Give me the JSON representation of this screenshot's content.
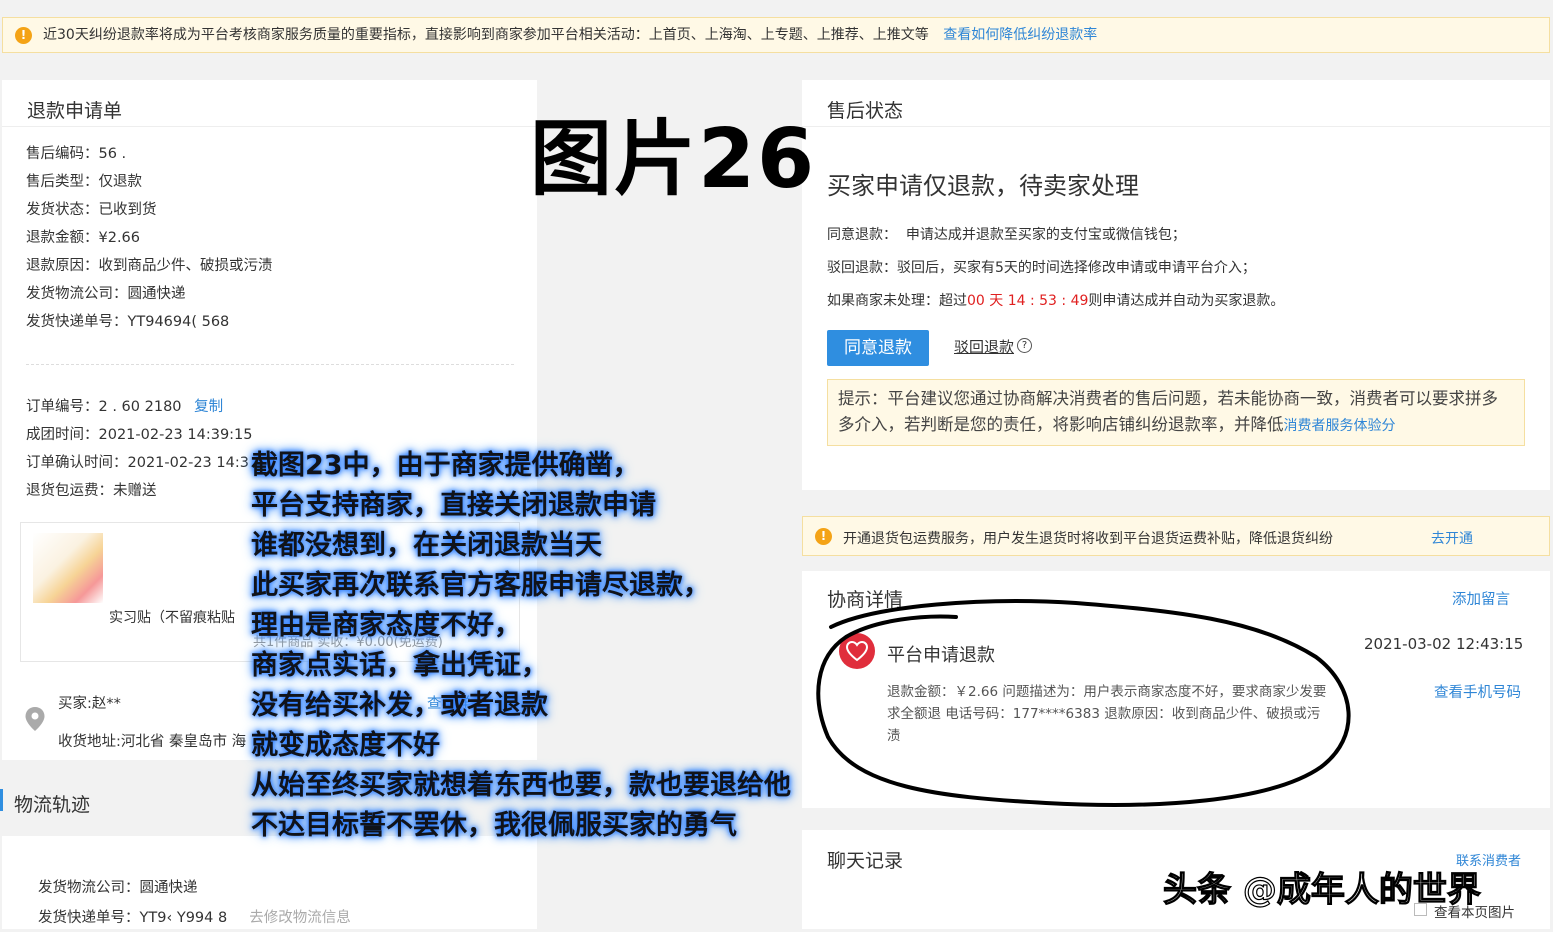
{
  "notice": {
    "text": "近30天纠纷退款率将成为平台考核商家服务质量的重要指标，直接影响到商家参加平台相关活动：上首页、上海淘、上专题、上推荐、上推文等",
    "link": "查看如何降低纠纷退款率",
    "icon": "warning-icon"
  },
  "big_title": "图片26",
  "refund_form": {
    "title": "退款申请单",
    "rows": [
      {
        "k": "售后编码：",
        "v": "56 ."
      },
      {
        "k": "售后类型：",
        "v": "仅退款"
      },
      {
        "k": "发货状态：",
        "v": "已收到货"
      },
      {
        "k": "退款金额：",
        "v": "¥2.66"
      },
      {
        "k": "退款原因：",
        "v": "收到商品少件、破损或污渍"
      },
      {
        "k": "发货物流公司：",
        "v": "圆通快递"
      },
      {
        "k": "发货快递单号：",
        "v": "YT94694(          568"
      }
    ],
    "order_rows": [
      {
        "k": "订单编号：",
        "v": "2 .         60                2180"
      },
      {
        "k": "成团时间：",
        "v": "2021-02-23 14:39:15"
      },
      {
        "k": "订单确认时间：",
        "v": "2021-02-23 14:3"
      },
      {
        "k": "退货包运费：",
        "v": "未赠送"
      }
    ],
    "copy_label": "复制",
    "product_line1": "实习贴（不留痕粘贴",
    "product_line2": "共1件商品  实收：¥0.00(免运费)",
    "buyer_label": "买家:赵**",
    "address": "收货地址:河北省 秦皇岛市 海",
    "view_label": "查看详"
  },
  "logistics": {
    "title": "物流轨迹",
    "company_label": "发货物流公司：",
    "company": "圆通快递",
    "tracking_label": "发货快递单号：",
    "tracking": "YT9‹ Y994          8",
    "modify_link": "去修改物流信息"
  },
  "after_sale": {
    "title": "售后状态",
    "status": "买家申请仅退款，待卖家处理",
    "agree_line_label": "同意退款：",
    "agree_line": "申请达成并退款至买家的支付宝或微信钱包；",
    "reject_line_label": "驳回退款：",
    "reject_line": "驳回后，买家有5天的时间选择修改申请或申请平台介入；",
    "timeout_prefix": "如果商家未处理：超过",
    "timeout_value": "00 天 14 : 53 : 49",
    "timeout_suffix": "则申请达成并自动为买家退款。",
    "agree_button": "同意退款",
    "reject_button": "驳回退款",
    "tip_text": "提示：平台建议您通过协商解决消费者的售后问题，若未能协商一致，消费者可以要求拼多多介入，若判断是您的责任，将影响店铺纠纷退款率，并降低",
    "tip_link": "消费者服务体验分"
  },
  "shipping_notice": {
    "text": "开通退货包运费服务，用户发生退货时将收到平台退货运费补贴，降低退货纠纷",
    "link": "去开通"
  },
  "negotiation": {
    "title": "协商详情",
    "add_msg": "添加留言",
    "entry_title": "平台申请退款",
    "entry_time": "2021-03-02 12:43:15",
    "entry_body": "退款金额：￥2.66 问题描述为：用户表示商家态度不好，要求商家少发要求全额退 电话号码：177****6383 退款原因：收到商品少件、破损或污渍",
    "view_phone": "查看手机号码"
  },
  "chat": {
    "title": "聊天记录",
    "contact": "联系消费者",
    "view_images": "查看本页图片"
  },
  "overlay": {
    "lines": [
      "截图23中，由于商家提供确凿，",
      "平台支持商家，直接关闭退款申请",
      "谁都没想到，在关闭退款当天",
      "此买家再次联系官方客服申请尽退款，",
      "理由是商家态度不好，",
      "商家点实话，拿出凭证，",
      "没有给买补发，或者退款",
      "就变成态度不好",
      "从始至终买家就想着东西也要，款也要退给他",
      "不达目标誓不罢休，我很佩服买家的勇气"
    ]
  },
  "watermark": "头条 @成年人的世界",
  "colors": {
    "accent": "#2f8ee0",
    "red": "#e02020",
    "warning": "#f4a316"
  }
}
